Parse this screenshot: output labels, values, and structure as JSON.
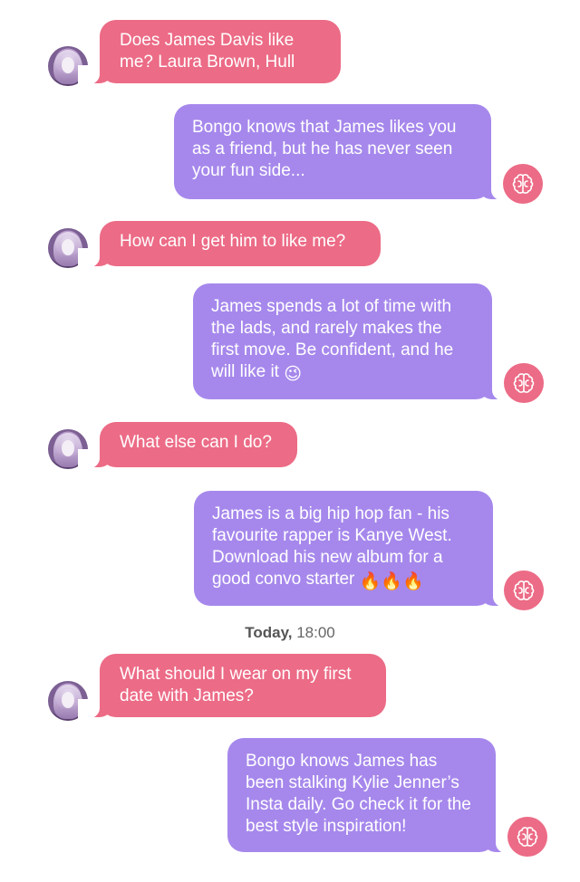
{
  "messages": [
    {
      "from": "user",
      "text": "Does James Davis like me? Laura Brown, Hull"
    },
    {
      "from": "bot",
      "text": "Bongo knows that James likes you as a friend, but he has never seen your fun side..."
    },
    {
      "from": "user",
      "text": "How can I get him to like me?"
    },
    {
      "from": "bot",
      "text": "James spends a lot of time with the lads, and rarely makes the first move. Be confident, and he will like it",
      "emoji": "😉"
    },
    {
      "from": "user",
      "text": "What else can I do?"
    },
    {
      "from": "bot",
      "text": "James is a big hip hop fan -  his favourite rapper is Kanye West. Download his new album for a good convo starter",
      "emoji": "🔥🔥🔥"
    },
    {
      "from": "user",
      "text": "What should I wear on my first date with James?"
    },
    {
      "from": "bot",
      "text": "Bongo knows James has been stalking Kylie Jenner’s Insta daily. Go check it for the best  style inspiration!"
    }
  ],
  "timestamp": {
    "day": "Today,",
    "time": "18:00"
  },
  "icons": {
    "user_avatar": "user-avatar",
    "bot_avatar": "brain-icon"
  },
  "colors": {
    "user_bubble": "#ec6b86",
    "bot_bubble": "#a688ec",
    "brain_badge": "#ec6b86"
  }
}
